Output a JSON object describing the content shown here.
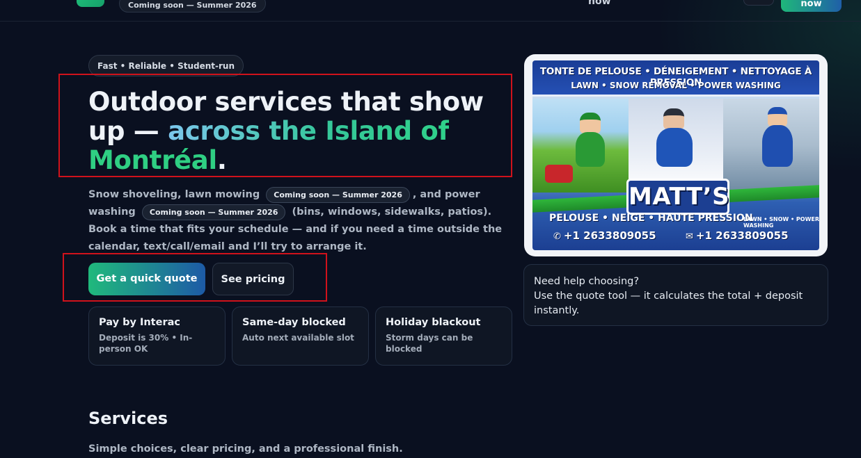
{
  "topbar": {
    "coming_soon_pill": "Coming soon — Summer 2026",
    "nav_now": "now",
    "cta_label": "now"
  },
  "hero": {
    "tag": "Fast • Reliable • Student-run",
    "title_part1": "Outdoor services that show up — ",
    "title_grad": "across the Island of ",
    "title_grad2": "Montréal",
    "title_end": ".",
    "desc_1": "Snow shoveling, lawn mowing",
    "pill_1": "Coming soon — Summer 2026",
    "desc_2": ", and power washing",
    "pill_2": "Coming soon — Summer 2026",
    "desc_3": "(bins, windows, sidewalks, patios). Book a time that fits your schedule — and if you need a time outside the calendar, text/call/email and I’ll try to arrange it.",
    "primary_button": "Get a quick quote",
    "secondary_button": "See pricing"
  },
  "features": [
    {
      "title": "Pay by Interac",
      "text": "Deposit is 30% • In-person OK"
    },
    {
      "title": "Same-day blocked",
      "text": "Auto next available slot"
    },
    {
      "title": "Holiday blackout",
      "text": "Storm days can be blocked"
    }
  ],
  "services": {
    "title": "Services",
    "subtitle": "Simple choices, clear pricing, and a professional finish."
  },
  "poster": {
    "line1": "TONTE DE PELOUSE • DÉNEIGEMENT • NETTOYAGE À PRESSION",
    "line2": "LAWN • SNOW REMOVAL • POWER WASHING",
    "brand": "MATT’S",
    "line3": "PELOUSE • NEIGE • HAUTE PRESSION",
    "line3_small": "LAWN • SNOW • POWER WASHING",
    "phone_1": "+1 2633809055",
    "phone_2": "+1 2633809055"
  },
  "help": {
    "line1": "Need help choosing?",
    "line2": "Use the quote tool — it calculates the total + deposit instantly."
  },
  "colors": {
    "background": "#0a1020",
    "accent_green": "#2fcf83",
    "accent_blue": "#1d5aa6",
    "annotation_red": "#d0121b"
  }
}
